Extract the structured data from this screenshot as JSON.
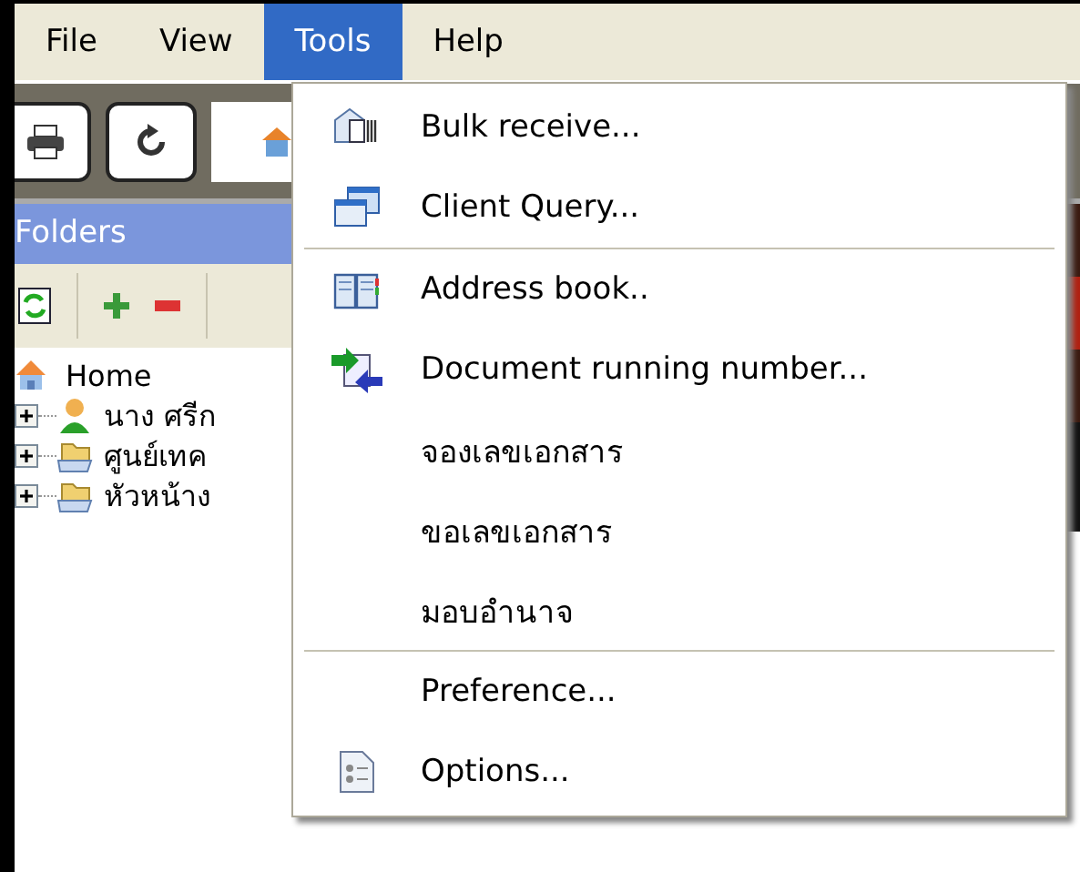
{
  "menubar": [
    {
      "label": "File",
      "selected": false
    },
    {
      "label": "View",
      "selected": false
    },
    {
      "label": "Tools",
      "selected": true
    },
    {
      "label": "Help",
      "selected": false
    }
  ],
  "folders": {
    "title": "Folders",
    "tree": [
      {
        "label": "Home",
        "kind": "home",
        "children": [
          {
            "label": "นาง ศรีก",
            "kind": "person",
            "expanded": false
          },
          {
            "label": "ศูนย์เทค",
            "kind": "folder",
            "expanded": false
          },
          {
            "label": "หัวหน้าง",
            "kind": "folder",
            "expanded": false
          }
        ]
      }
    ]
  },
  "menu": {
    "items": [
      {
        "kind": "item",
        "label": "Bulk receive..."
      },
      {
        "kind": "item",
        "label": "Client Query..."
      },
      {
        "kind": "separator"
      },
      {
        "kind": "item",
        "label": "Address book.."
      },
      {
        "kind": "item",
        "label": "Document running number..."
      },
      {
        "kind": "item",
        "label": "จองเลขเอกสาร"
      },
      {
        "kind": "item",
        "label": "ขอเลขเอกสาร"
      },
      {
        "kind": "item",
        "label": "มอบอำนาจ"
      },
      {
        "kind": "separator"
      },
      {
        "kind": "item",
        "label": "Preference..."
      },
      {
        "kind": "item",
        "label": "Options..."
      }
    ]
  }
}
